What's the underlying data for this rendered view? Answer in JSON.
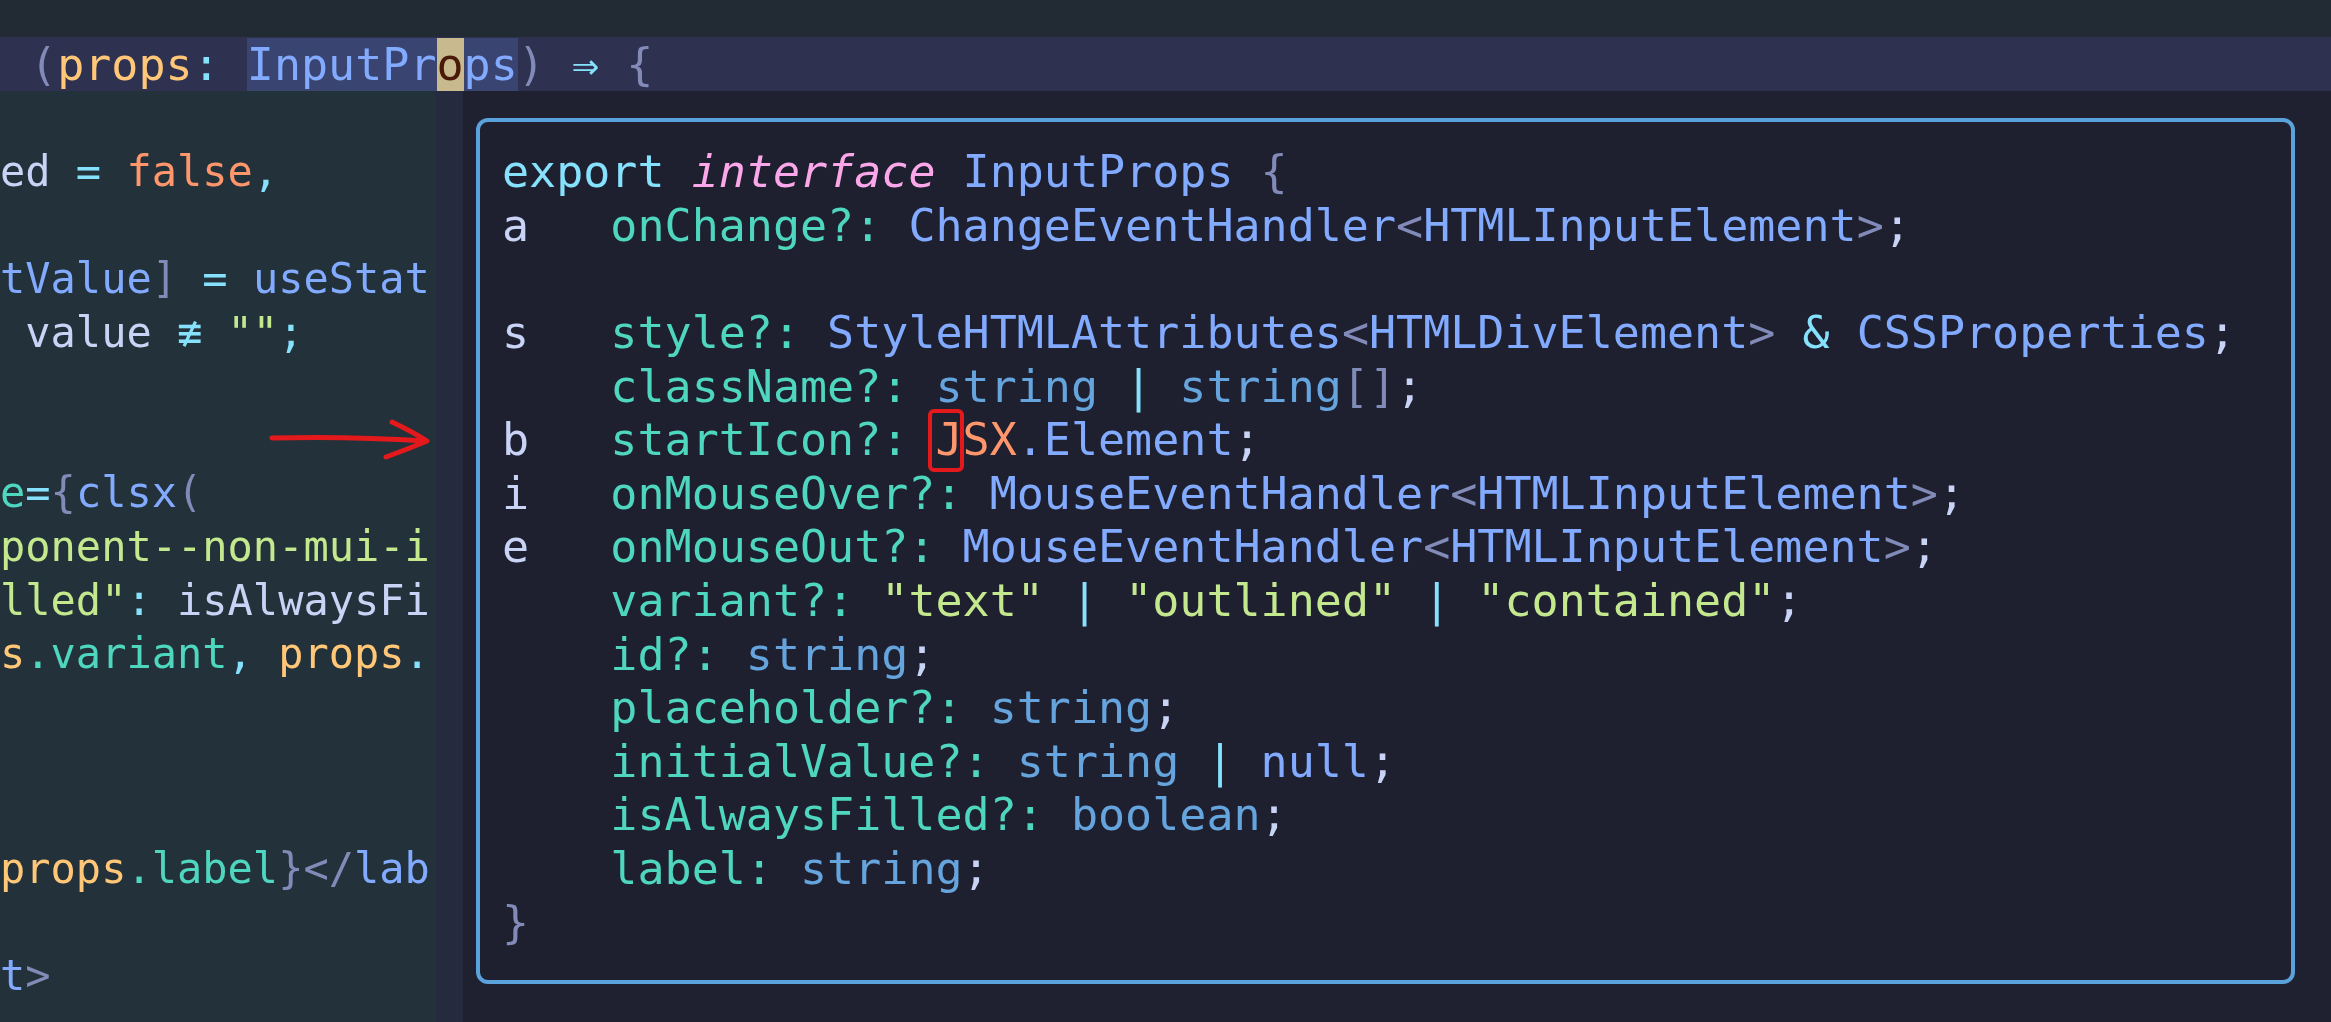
{
  "current_line": {
    "tokens": [
      {
        "text": " (",
        "kind": "bracket",
        "selected": false,
        "cursor": false
      },
      {
        "text": "props",
        "kind": "param",
        "selected": false,
        "cursor": false
      },
      {
        "text": ": ",
        "kind": "op",
        "selected": false,
        "cursor": false
      },
      {
        "text": "InputPr",
        "kind": "type",
        "selected": true,
        "cursor": false
      },
      {
        "text": "o",
        "kind": "type",
        "selected": true,
        "cursor": true
      },
      {
        "text": "ps",
        "kind": "type",
        "selected": true,
        "cursor": false
      },
      {
        "text": ")",
        "kind": "bracket",
        "selected": false,
        "cursor": false
      },
      {
        "text": " ⇒ ",
        "kind": "op",
        "selected": false,
        "cursor": false
      },
      {
        "text": "{",
        "kind": "bracket",
        "selected": false,
        "cursor": false
      }
    ]
  },
  "editor_lines": [
    {
      "kind": "blank"
    },
    {
      "kind": "code",
      "tokens": [
        {
          "text": "ed",
          "kind": "plain"
        },
        {
          "text": " = ",
          "kind": "op"
        },
        {
          "text": "false",
          "kind": "jsx"
        },
        {
          "text": ",",
          "kind": "op"
        }
      ]
    },
    {
      "kind": "blank"
    },
    {
      "kind": "code",
      "tokens": [
        {
          "text": "tValue",
          "kind": "type"
        },
        {
          "text": "]",
          "kind": "bracket"
        },
        {
          "text": " = ",
          "kind": "op"
        },
        {
          "text": "useStat",
          "kind": "type"
        }
      ]
    },
    {
      "kind": "code",
      "tokens": [
        {
          "text": " value",
          "kind": "plain"
        },
        {
          "text": " ≢ ",
          "kind": "op"
        },
        {
          "text": "\"\"",
          "kind": "string"
        },
        {
          "text": ";",
          "kind": "op"
        }
      ]
    },
    {
      "kind": "blank"
    },
    {
      "kind": "blank"
    },
    {
      "kind": "code",
      "tokens": [
        {
          "text": "e",
          "kind": "prop"
        },
        {
          "text": "=",
          "kind": "op"
        },
        {
          "text": "{",
          "kind": "bracket"
        },
        {
          "text": "clsx",
          "kind": "type"
        },
        {
          "text": "(",
          "kind": "bracket"
        }
      ]
    },
    {
      "kind": "code",
      "tokens": [
        {
          "text": "ponent--non-mui-i",
          "kind": "string"
        }
      ]
    },
    {
      "kind": "code",
      "tokens": [
        {
          "text": "lled\"",
          "kind": "string"
        },
        {
          "text": ": ",
          "kind": "op"
        },
        {
          "text": "isAlwaysFi",
          "kind": "plain"
        }
      ]
    },
    {
      "kind": "code",
      "tokens": [
        {
          "text": "s",
          "kind": "param"
        },
        {
          "text": ".variant",
          "kind": "prop"
        },
        {
          "text": ", ",
          "kind": "op"
        },
        {
          "text": "props",
          "kind": "param"
        },
        {
          "text": ".",
          "kind": "op"
        }
      ]
    },
    {
      "kind": "blank"
    },
    {
      "kind": "blank"
    },
    {
      "kind": "blank"
    },
    {
      "kind": "code",
      "tokens": [
        {
          "text": "props",
          "kind": "param"
        },
        {
          "text": ".label",
          "kind": "prop"
        },
        {
          "text": "}",
          "kind": "bracket"
        },
        {
          "text": "</",
          "kind": "bracket"
        },
        {
          "text": "lab",
          "kind": "type"
        }
      ]
    },
    {
      "kind": "blank"
    },
    {
      "kind": "code",
      "tokens": [
        {
          "text": "t",
          "kind": "type"
        },
        {
          "text": ">",
          "kind": "bracket"
        }
      ]
    }
  ],
  "popup": {
    "header": [
      {
        "text": "export ",
        "kind": "keyword"
      },
      {
        "text": "interface",
        "kind": "storage"
      },
      {
        "text": " InputProps ",
        "kind": "type"
      },
      {
        "text": "{",
        "kind": "bracket"
      }
    ],
    "members": [
      {
        "kind": "code",
        "hint": "a",
        "tokens": [
          {
            "text": "onChange?: ",
            "kind": "prop"
          },
          {
            "text": "ChangeEventHandler",
            "kind": "type"
          },
          {
            "text": "<",
            "kind": "bracket"
          },
          {
            "text": "HTMLInputElement",
            "kind": "type"
          },
          {
            "text": ">",
            "kind": "bracket"
          },
          {
            "text": ";",
            "kind": "punct"
          }
        ]
      },
      {
        "kind": "blank"
      },
      {
        "kind": "code",
        "hint": "s",
        "tokens": [
          {
            "text": "style?: ",
            "kind": "prop"
          },
          {
            "text": "StyleHTMLAttributes",
            "kind": "type"
          },
          {
            "text": "<",
            "kind": "bracket"
          },
          {
            "text": "HTMLDivElement",
            "kind": "type"
          },
          {
            "text": ">",
            "kind": "bracket"
          },
          {
            "text": " & ",
            "kind": "op"
          },
          {
            "text": "CSSProperties",
            "kind": "type"
          },
          {
            "text": ";",
            "kind": "punct"
          }
        ]
      },
      {
        "kind": "code",
        "tokens": [
          {
            "text": "className?: ",
            "kind": "prop"
          },
          {
            "text": "string",
            "kind": "builtin"
          },
          {
            "text": " | ",
            "kind": "op"
          },
          {
            "text": "string",
            "kind": "builtin"
          },
          {
            "text": "[]",
            "kind": "bracket"
          },
          {
            "text": ";",
            "kind": "punct"
          }
        ]
      },
      {
        "kind": "code",
        "hint": "b",
        "tokens": [
          {
            "text": "startIcon?: ",
            "kind": "prop"
          },
          {
            "text": "J",
            "kind": "jsx",
            "annotated": true
          },
          {
            "text": "SX",
            "kind": "jsx"
          },
          {
            "text": ".Element",
            "kind": "type"
          },
          {
            "text": ";",
            "kind": "punct"
          }
        ]
      },
      {
        "kind": "code",
        "hint": "i",
        "tokens": [
          {
            "text": "onMouseOver?: ",
            "kind": "prop"
          },
          {
            "text": "MouseEventHandler",
            "kind": "type"
          },
          {
            "text": "<",
            "kind": "bracket"
          },
          {
            "text": "HTMLInputElement",
            "kind": "type"
          },
          {
            "text": ">",
            "kind": "bracket"
          },
          {
            "text": ";",
            "kind": "punct"
          }
        ]
      },
      {
        "kind": "code",
        "hint": "e",
        "tokens": [
          {
            "text": "onMouseOut?: ",
            "kind": "prop"
          },
          {
            "text": "MouseEventHandler",
            "kind": "type"
          },
          {
            "text": "<",
            "kind": "bracket"
          },
          {
            "text": "HTMLInputElement",
            "kind": "type"
          },
          {
            "text": ">",
            "kind": "bracket"
          },
          {
            "text": ";",
            "kind": "punct"
          }
        ]
      },
      {
        "kind": "code",
        "tokens": [
          {
            "text": "variant?: ",
            "kind": "prop"
          },
          {
            "text": "\"text\"",
            "kind": "string"
          },
          {
            "text": " | ",
            "kind": "op"
          },
          {
            "text": "\"outlined\"",
            "kind": "string"
          },
          {
            "text": " | ",
            "kind": "op"
          },
          {
            "text": "\"contained\"",
            "kind": "string"
          },
          {
            "text": ";",
            "kind": "punct"
          }
        ]
      },
      {
        "kind": "code",
        "tokens": [
          {
            "text": "id?: ",
            "kind": "prop"
          },
          {
            "text": "string",
            "kind": "builtin"
          },
          {
            "text": ";",
            "kind": "punct"
          }
        ]
      },
      {
        "kind": "code",
        "tokens": [
          {
            "text": "placeholder?: ",
            "kind": "prop"
          },
          {
            "text": "string",
            "kind": "builtin"
          },
          {
            "text": ";",
            "kind": "punct"
          }
        ]
      },
      {
        "kind": "code",
        "tokens": [
          {
            "text": "initialValue?: ",
            "kind": "prop"
          },
          {
            "text": "string",
            "kind": "builtin"
          },
          {
            "text": " | ",
            "kind": "op"
          },
          {
            "text": "null",
            "kind": "type"
          },
          {
            "text": ";",
            "kind": "punct"
          }
        ]
      },
      {
        "kind": "code",
        "tokens": [
          {
            "text": "isAlwaysFilled?: ",
            "kind": "prop"
          },
          {
            "text": "boolean",
            "kind": "builtin"
          },
          {
            "text": ";",
            "kind": "punct"
          }
        ]
      },
      {
        "kind": "code",
        "tokens": [
          {
            "text": "label: ",
            "kind": "prop"
          },
          {
            "text": "string",
            "kind": "builtin"
          },
          {
            "text": ";",
            "kind": "punct"
          }
        ]
      }
    ],
    "footer": [
      {
        "text": "}",
        "kind": "bracket"
      }
    ]
  }
}
